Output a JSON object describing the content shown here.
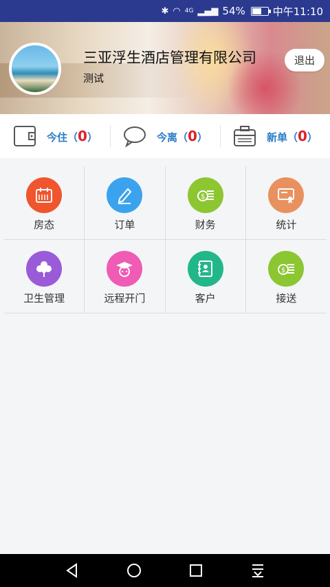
{
  "status_bar": {
    "battery_pct": "54%",
    "time": "中午11:10",
    "network": "4G"
  },
  "header": {
    "company": "三亚浮生酒店管理有限公司",
    "user": "测试",
    "logout_label": "退出"
  },
  "stats": [
    {
      "label": "今住",
      "value": "0"
    },
    {
      "label": "今离",
      "value": "0"
    },
    {
      "label": "新单",
      "value": "0"
    }
  ],
  "menu": [
    {
      "label": "房态",
      "color": "#f0552e",
      "icon": "calendar-icon"
    },
    {
      "label": "订单",
      "color": "#3ba3ee",
      "icon": "pencil-icon"
    },
    {
      "label": "财务",
      "color": "#8cc631",
      "icon": "money-icon"
    },
    {
      "label": "统计",
      "color": "#e9915e",
      "icon": "certificate-icon"
    },
    {
      "label": "卫生管理",
      "color": "#9a5bd9",
      "icon": "clover-icon"
    },
    {
      "label": "远程开门",
      "color": "#ef5bb5",
      "icon": "graduate-icon"
    },
    {
      "label": "客户",
      "color": "#22b78a",
      "icon": "contacts-icon"
    },
    {
      "label": "接送",
      "color": "#8cc631",
      "icon": "money-icon"
    }
  ]
}
